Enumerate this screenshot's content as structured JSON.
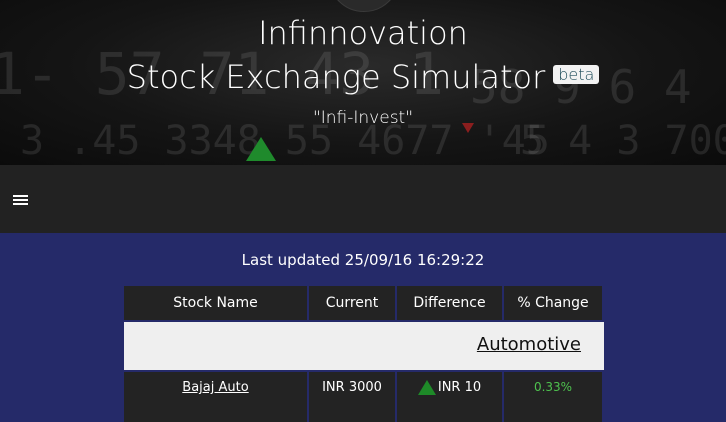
{
  "header": {
    "title_line1": "Infinnovation",
    "title_line2": "Stock Exchange Simulator",
    "badge": "beta",
    "tagline": "\"Infi-Invest\""
  },
  "nav": {
    "menu_icon": "hamburger-icon"
  },
  "status": {
    "last_updated": "Last updated 25/09/16 16:29:22"
  },
  "table": {
    "headers": [
      "Stock Name",
      "Current",
      "Difference",
      "% Change"
    ],
    "category": "Automotive",
    "rows": [
      {
        "name": "Bajaj Auto",
        "current": "INR 3000",
        "difference": "INR 10",
        "pct_change": "0.33%",
        "direction": "up"
      }
    ]
  },
  "colors": {
    "page_bg": "#252a69",
    "nav_bg": "#222222",
    "up": "#1e8a28",
    "pct_positive": "#4ec24e"
  }
}
